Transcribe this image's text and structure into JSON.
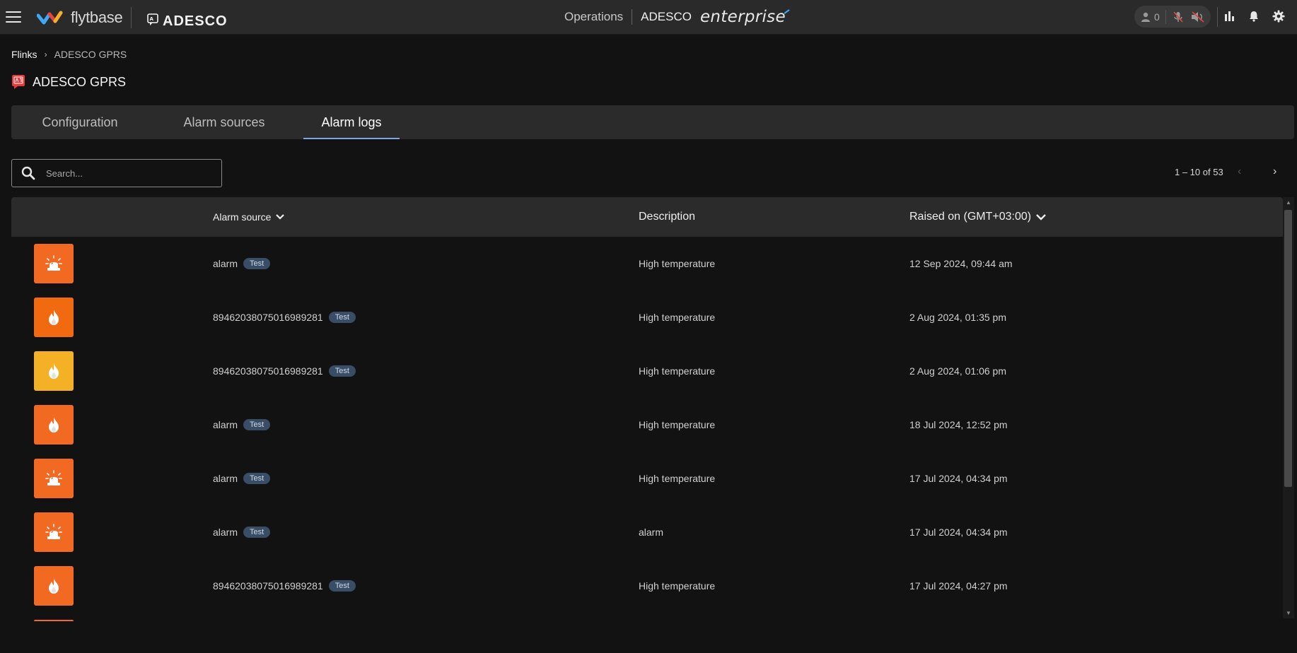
{
  "topbar": {
    "brand": "flytbase",
    "org_logo": "ADESCO",
    "section": "Operations",
    "org": "ADESCO",
    "edition": "enterprise",
    "user_count": "0"
  },
  "breadcrumb": {
    "root": "Flinks",
    "current": "ADESCO GPRS"
  },
  "page_title": "ADESCO GPRS",
  "tabs": [
    {
      "label": "Configuration"
    },
    {
      "label": "Alarm sources"
    },
    {
      "label": "Alarm logs",
      "active": true
    }
  ],
  "search": {
    "placeholder": "Search...",
    "value": ""
  },
  "pagination": {
    "range": "1 – 10 of 53"
  },
  "table": {
    "columns": {
      "source": "Alarm source",
      "description": "Description",
      "raised_on": "Raised on (GMT+03:00)"
    },
    "rows": [
      {
        "icon": "siren-icon",
        "color": "#f26a21",
        "source": "alarm",
        "tag": "Test",
        "description": "High temperature",
        "raised_on": "12 Sep 2024, 09:44 am"
      },
      {
        "icon": "flame-icon",
        "color": "#f26a10",
        "source": "8946203807501698928​1",
        "tag": "Test",
        "description": "High temperature",
        "raised_on": "2 Aug 2024, 01:35 pm"
      },
      {
        "icon": "flame-icon",
        "color": "#f5b125",
        "source": "8946203807501698928​1",
        "tag": "Test",
        "description": "High temperature",
        "raised_on": "2 Aug 2024, 01:06 pm"
      },
      {
        "icon": "flame-icon",
        "color": "#f26a21",
        "source": "alarm",
        "tag": "Test",
        "description": "High temperature",
        "raised_on": "18 Jul 2024, 12:52 pm"
      },
      {
        "icon": "siren-icon",
        "color": "#f26a21",
        "source": "alarm",
        "tag": "Test",
        "description": "High temperature",
        "raised_on": "17 Jul 2024, 04:34 pm"
      },
      {
        "icon": "siren-icon",
        "color": "#f26a21",
        "source": "alarm",
        "tag": "Test",
        "description": "alarm",
        "raised_on": "17 Jul 2024, 04:34 pm"
      },
      {
        "icon": "flame-icon",
        "color": "#f26a21",
        "source": "8946203807501698928​1",
        "tag": "Test",
        "description": "High temperature",
        "raised_on": "17 Jul 2024, 04:27 pm"
      }
    ]
  },
  "colors": {
    "accent": "#7aa6e6",
    "tag_bg": "#3a4d66",
    "orange": "#f26a21",
    "amber": "#f5b125"
  }
}
